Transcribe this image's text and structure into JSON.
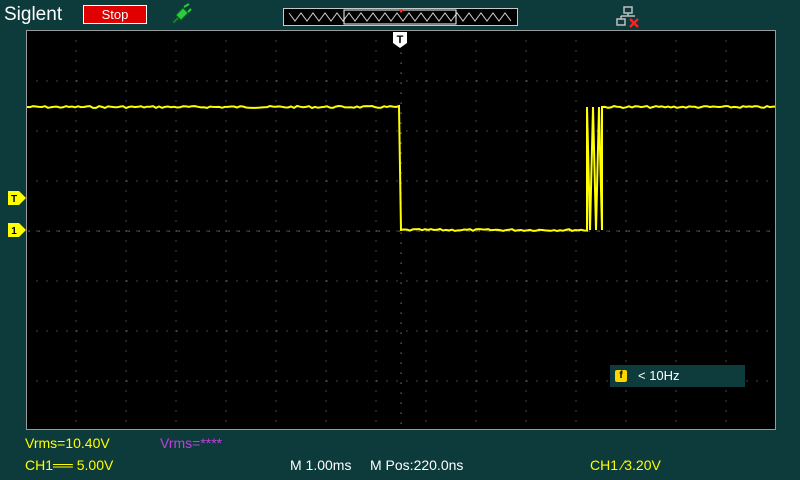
{
  "header": {
    "brand": "Siglent",
    "run_state": "Stop",
    "probe_icon": "probe-icon",
    "network_icon": "network-disconnected-icon"
  },
  "screen": {
    "trigger_marker": "T",
    "channel_marker": "1",
    "level_marker": "T"
  },
  "frequency_readout": {
    "badge": "f",
    "value": "< 10Hz"
  },
  "measurements": {
    "vrms_ch1": "Vrms=10.40V",
    "vrms_ch2": "Vrms=****"
  },
  "status": {
    "ch1_scale": "CH1══ 5.00V",
    "timebase": "M 1.00ms",
    "position": "M Pos:220.0ns",
    "trigger": "CH1 ∕3.20V"
  },
  "colors": {
    "background": "#0d3a3a",
    "trace": "#ffff00",
    "stop": "#e00000",
    "ch2": "#c040e0"
  }
}
